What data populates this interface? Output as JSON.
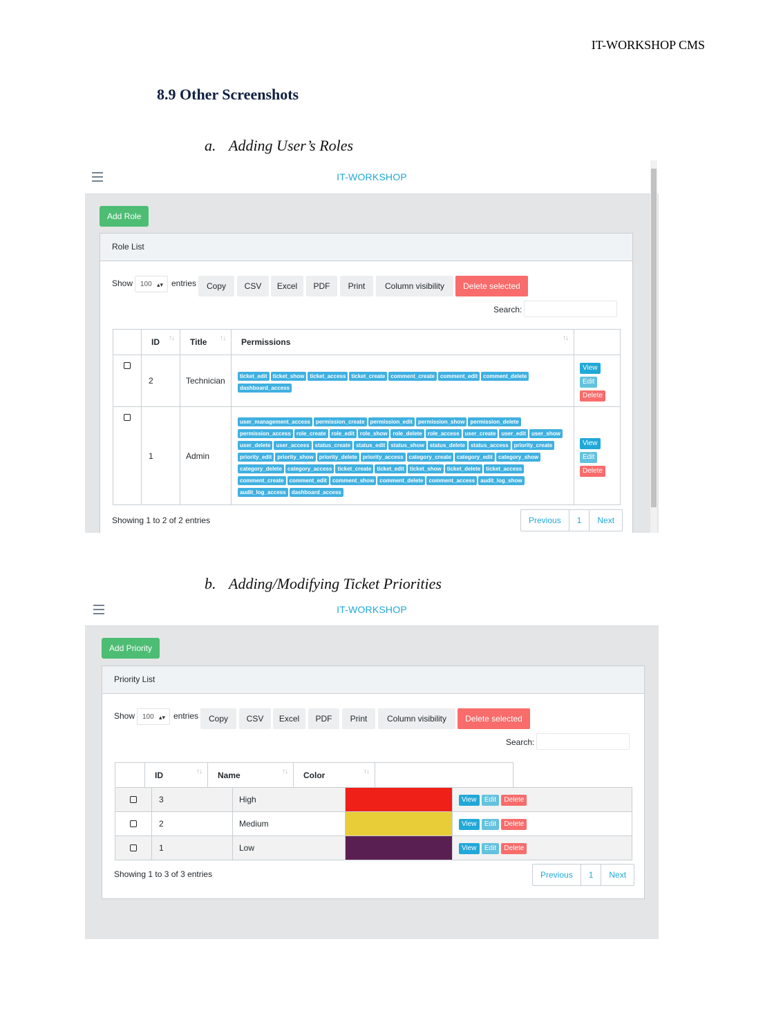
{
  "running_header": "IT-WORKSHOP CMS",
  "section_heading": "8.9 Other Screenshots",
  "colors": {
    "brand": "#20a8d8",
    "success": "#4dbd74",
    "danger": "#f86c6b",
    "info": "#63c2de"
  },
  "roles_screen": {
    "caption": {
      "label": "a.",
      "text": "Adding User’s Roles"
    },
    "brand": "IT-WORKSHOP",
    "add_button": "Add Role",
    "card_title": "Role List",
    "show_label": "Show",
    "entries_value": "100",
    "entries_label": "entries",
    "buttons": [
      "Copy",
      "CSV",
      "Excel",
      "PDF",
      "Print",
      "Column visibility",
      "Delete selected"
    ],
    "search_label": "Search:",
    "columns": [
      "ID",
      "Title",
      "Permissions"
    ],
    "rows": [
      {
        "id": "2",
        "title": "Technician",
        "permissions": [
          "ticket_edit",
          "ticket_show",
          "ticket_access",
          "ticket_create",
          "comment_create",
          "comment_edit",
          "comment_delete",
          "dashboard_access"
        ]
      },
      {
        "id": "1",
        "title": "Admin",
        "permissions": [
          "user_management_access",
          "permission_create",
          "permission_edit",
          "permission_show",
          "permission_delete",
          "permission_access",
          "role_create",
          "role_edit",
          "role_show",
          "role_delete",
          "role_access",
          "user_create",
          "user_edit",
          "user_show",
          "user_delete",
          "user_access",
          "status_create",
          "status_edit",
          "status_show",
          "status_delete",
          "status_access",
          "priority_create",
          "priority_edit",
          "priority_show",
          "priority_delete",
          "priority_access",
          "category_create",
          "category_edit",
          "category_show",
          "category_delete",
          "category_access",
          "ticket_create",
          "ticket_edit",
          "ticket_show",
          "ticket_delete",
          "ticket_access",
          "comment_create",
          "comment_edit",
          "comment_show",
          "comment_delete",
          "comment_access",
          "audit_log_show",
          "audit_log_access",
          "dashboard_access"
        ]
      }
    ],
    "actions": [
      "View",
      "Edit",
      "Delete"
    ],
    "showing_text": "Showing 1 to 2 of 2 entries",
    "pagination": [
      "Previous",
      "1",
      "Next"
    ]
  },
  "priorities_screen": {
    "caption": {
      "label": "b.",
      "text": "Adding/Modifying Ticket Priorities"
    },
    "brand": "IT-WORKSHOP",
    "add_button": "Add Priority",
    "card_title": "Priority List",
    "show_label": "Show",
    "entries_value": "100",
    "entries_label": "entries",
    "buttons": [
      "Copy",
      "CSV",
      "Excel",
      "PDF",
      "Print",
      "Column visibility",
      "Delete selected"
    ],
    "search_label": "Search:",
    "columns": [
      "ID",
      "Name",
      "Color"
    ],
    "rows": [
      {
        "id": "3",
        "name": "High",
        "color": "#ee2018"
      },
      {
        "id": "2",
        "name": "Medium",
        "color": "#e8cd38"
      },
      {
        "id": "1",
        "name": "Low",
        "color": "#5a1f52"
      }
    ],
    "actions": [
      "View",
      "Edit",
      "Delete"
    ],
    "showing_text": "Showing 1 to 3 of 3 entries",
    "pagination": [
      "Previous",
      "1",
      "Next"
    ]
  }
}
